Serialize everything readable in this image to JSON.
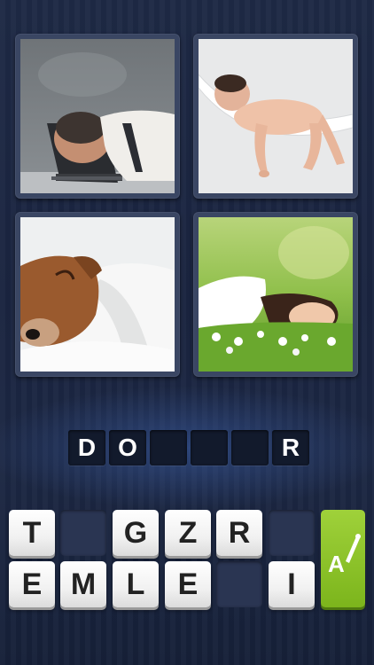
{
  "puzzle": {
    "pictures": [
      {
        "id": "man-laptop",
        "label": "man asleep on laptop"
      },
      {
        "id": "baby-hammock",
        "label": "baby asleep in hammock"
      },
      {
        "id": "dog-bed",
        "label": "dog asleep in bed"
      },
      {
        "id": "woman-grass",
        "label": "woman asleep in grass"
      }
    ],
    "answer_slots": [
      "D",
      "O",
      "",
      "",
      "",
      "R"
    ],
    "letter_keys_row1": [
      "T",
      "",
      "G",
      "Z",
      "R",
      ""
    ],
    "letter_keys_row2": [
      "E",
      "M",
      "L",
      "E",
      "",
      "I"
    ]
  },
  "hint": {
    "icon": "magic-wand-letter-icon",
    "glyph": "A"
  },
  "colors": {
    "background": "#1b2540",
    "hint_green": "#8bc12a",
    "slot_dark": "#121a2c"
  }
}
